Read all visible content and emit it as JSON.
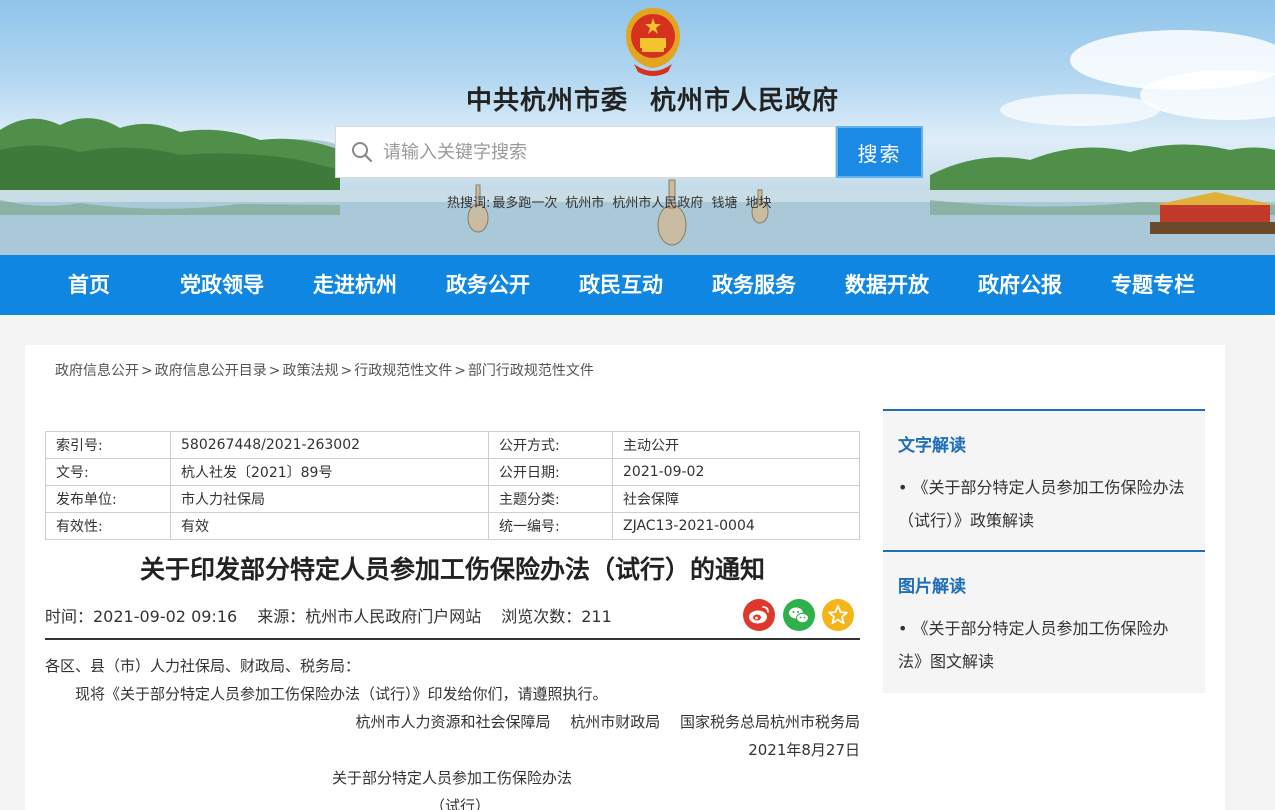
{
  "header": {
    "org1": "中共杭州市委",
    "org2": "杭州市人民政府",
    "search_placeholder": "请输入关键字搜索",
    "search_button": "搜索",
    "hot_label": "热搜词:",
    "hot_words": [
      "最多跑一次",
      "杭州市",
      "杭州市人民政府",
      "钱塘",
      "地块"
    ]
  },
  "nav": [
    "首页",
    "党政领导",
    "走进杭州",
    "政务公开",
    "政民互动",
    "政务服务",
    "数据开放",
    "政府公报",
    "专题专栏"
  ],
  "breadcrumb": [
    "政府信息公开",
    "政府信息公开目录",
    "政策法规",
    "行政规范性文件",
    "部门行政规范性文件"
  ],
  "breadcrumb_sep": ">",
  "meta": [
    [
      "索引号:",
      "580267448/2021-263002",
      "公开方式:",
      "主动公开"
    ],
    [
      "文号:",
      "杭人社发〔2021〕89号",
      "公开日期:",
      "2021-09-02"
    ],
    [
      "发布单位:",
      "市人力社保局",
      "主题分类:",
      "社会保障"
    ],
    [
      "有效性:",
      "有效",
      "统一编号:",
      "ZJAC13-2021-0004"
    ]
  ],
  "article": {
    "title": "关于印发部分特定人员参加工伤保险办法（试行）的通知",
    "time": "时间：2021-09-02 09:16",
    "source": "来源：杭州市人民政府门户网站",
    "views": "浏览次数：211",
    "salutation": "各区、县（市）人力社保局、财政局、税务局：",
    "para1": "现将《关于部分特定人员参加工伤保险办法（试行）》印发给你们，请遵照执行。",
    "issuers": "杭州市人力资源和社会保障局　 杭州市财政局　 国家税务总局杭州市税务局",
    "date": "2021年8月27日",
    "sub_title": "关于部分特定人员参加工伤保险办法",
    "sub_title2": "（试行）"
  },
  "sidebar": {
    "text_heading": "文字解读",
    "text_item": "•  《关于部分特定人员参加工伤保险办法（试行）》政策解读",
    "image_heading": "图片解读",
    "image_item": "•  《关于部分特定人员参加工伤保险办法》图文解读"
  },
  "colors": {
    "nav_bg": "#0e86e2",
    "search_btn": "#1a8ae5",
    "sidebar_heading": "#1e6fb8"
  }
}
